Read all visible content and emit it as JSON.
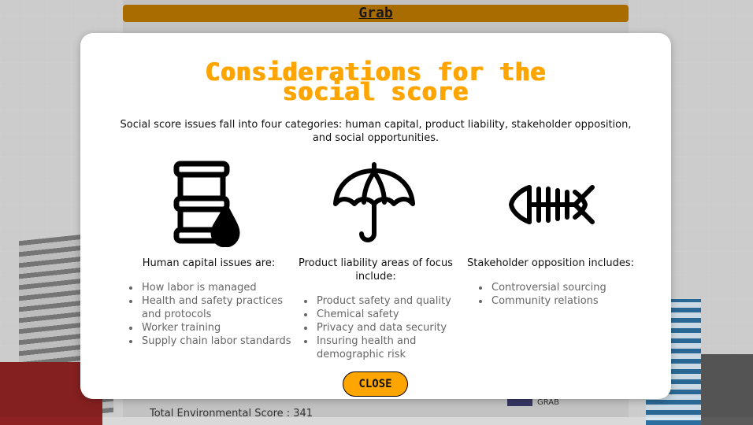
{
  "background": {
    "header_title": "Grab",
    "score_text": "Total Environmental Score : 341",
    "logo_text": "GRAB"
  },
  "modal": {
    "title_line1": "Considerations for the",
    "title_line2": "social score",
    "intro": "Social score issues fall into four categories: human capital, product liability, stakeholder opposition, and social opportunities.",
    "columns": [
      {
        "icon": "oil-barrel-icon",
        "heading": "Human capital issues are:",
        "items": [
          "How labor is managed",
          "Health and safety practices and protocols",
          "Worker training",
          "Supply chain labor standards"
        ]
      },
      {
        "icon": "umbrella-icon",
        "heading": "Product liability areas of focus include:",
        "items": [
          "Product safety and quality",
          "Chemical safety",
          "Privacy and data security",
          "Insuring health and demographic risk"
        ]
      },
      {
        "icon": "fish-bone-icon",
        "heading": "Stakeholder opposition includes:",
        "items": [
          "Controversial sourcing",
          "Community relations"
        ]
      }
    ],
    "close_label": "CLOSE",
    "accent_color": "#ffa500"
  }
}
